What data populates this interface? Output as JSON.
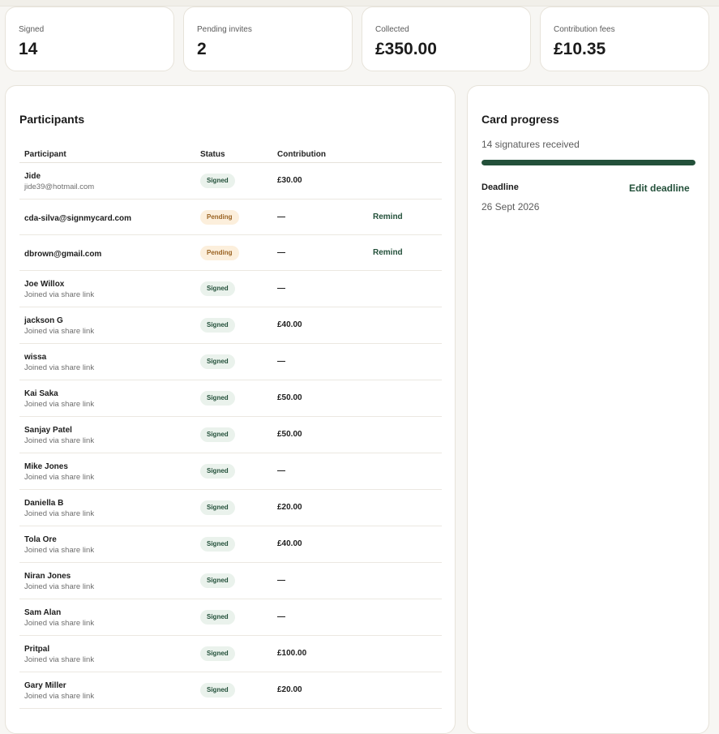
{
  "stats": [
    {
      "label": "Signed",
      "value": "14"
    },
    {
      "label": "Pending invites",
      "value": "2"
    },
    {
      "label": "Collected",
      "value": "£350.00"
    },
    {
      "label": "Contribution fees",
      "value": "£10.35"
    }
  ],
  "participants": {
    "title": "Participants",
    "columns": {
      "participant": "Participant",
      "status": "Status",
      "contribution": "Contribution"
    },
    "rows": [
      {
        "name": "Jide",
        "sub": "jide39@hotmail.com",
        "status": "Signed",
        "contribution": "£30.00",
        "action": ""
      },
      {
        "name": "cda-silva@signmycard.com",
        "sub": "",
        "status": "Pending",
        "contribution": "—",
        "action": "Remind"
      },
      {
        "name": "dbrown@gmail.com",
        "sub": "",
        "status": "Pending",
        "contribution": "—",
        "action": "Remind"
      },
      {
        "name": "Joe Willox",
        "sub": "Joined via share link",
        "status": "Signed",
        "contribution": "—",
        "action": ""
      },
      {
        "name": "jackson G",
        "sub": "Joined via share link",
        "status": "Signed",
        "contribution": "£40.00",
        "action": ""
      },
      {
        "name": "wissa",
        "sub": "Joined via share link",
        "status": "Signed",
        "contribution": "—",
        "action": ""
      },
      {
        "name": "Kai Saka",
        "sub": "Joined via share link",
        "status": "Signed",
        "contribution": "£50.00",
        "action": ""
      },
      {
        "name": "Sanjay Patel",
        "sub": "Joined via share link",
        "status": "Signed",
        "contribution": "£50.00",
        "action": ""
      },
      {
        "name": "Mike Jones",
        "sub": "Joined via share link",
        "status": "Signed",
        "contribution": "—",
        "action": ""
      },
      {
        "name": "Daniella B",
        "sub": "Joined via share link",
        "status": "Signed",
        "contribution": "£20.00",
        "action": ""
      },
      {
        "name": "Tola Ore",
        "sub": "Joined via share link",
        "status": "Signed",
        "contribution": "£40.00",
        "action": ""
      },
      {
        "name": "Niran Jones",
        "sub": "Joined via share link",
        "status": "Signed",
        "contribution": "—",
        "action": ""
      },
      {
        "name": "Sam Alan",
        "sub": "Joined via share link",
        "status": "Signed",
        "contribution": "—",
        "action": ""
      },
      {
        "name": "Pritpal",
        "sub": "Joined via share link",
        "status": "Signed",
        "contribution": "£100.00",
        "action": ""
      },
      {
        "name": "Gary Miller",
        "sub": "Joined via share link",
        "status": "Signed",
        "contribution": "£20.00",
        "action": ""
      }
    ]
  },
  "card_progress": {
    "title": "Card progress",
    "signatures_text": "14 signatures received",
    "progress_fraction": 1.0,
    "deadline_label": "Deadline",
    "edit_deadline_label": "Edit deadline",
    "deadline_date": "26 Sept 2026"
  },
  "colors": {
    "accent": "#23503a",
    "signed_bg": "#eaf2ec",
    "pending_bg": "#fcefdc",
    "pending_text": "#9a6322"
  }
}
